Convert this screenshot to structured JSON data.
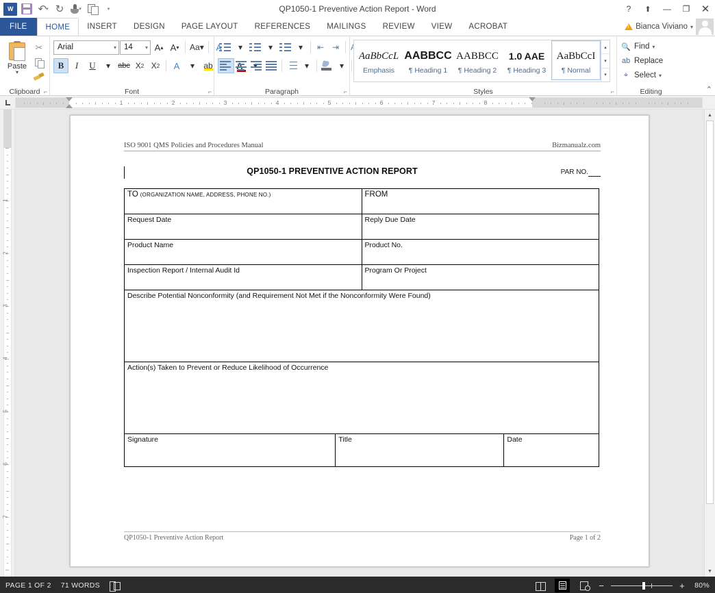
{
  "window": {
    "title": "QP1050-1 Preventive Action Report - Word",
    "quick_access": [
      {
        "name": "word-logo-icon",
        "label": "W"
      },
      {
        "name": "save-icon",
        "label": "Save"
      },
      {
        "name": "undo-icon",
        "label": "Undo"
      },
      {
        "name": "redo-icon",
        "label": "Redo"
      },
      {
        "name": "touch-mode-icon",
        "label": "Touch/Mouse Mode"
      },
      {
        "name": "copy-format-icon",
        "label": "Copy"
      },
      {
        "name": "customize-qat-icon",
        "label": "Customize Quick Access Toolbar"
      }
    ],
    "controls": {
      "help": "?",
      "ribbon_display": "⬆",
      "minimize": "—",
      "restore": "❐",
      "close": "✕"
    }
  },
  "tabs": {
    "file": "FILE",
    "items": [
      "HOME",
      "INSERT",
      "DESIGN",
      "PAGE LAYOUT",
      "REFERENCES",
      "MAILINGS",
      "REVIEW",
      "VIEW",
      "ACROBAT"
    ],
    "active": "HOME"
  },
  "account": {
    "name": "Bianca Viviano",
    "caret": "▾"
  },
  "ribbon": {
    "collapse_caret": "⌃",
    "groups": {
      "clipboard": {
        "label": "Clipboard",
        "paste_label": "Paste",
        "paste_caret": "▾",
        "dialog_launcher": "⌐",
        "cut_label": "Cut",
        "copy_label": "Copy",
        "format_painter_label": "Format Painter"
      },
      "font": {
        "label": "Font",
        "dialog_launcher": "⌐",
        "font_name": "Arial",
        "font_size": "14",
        "caret": "▾",
        "grow_font": "A",
        "shrink_font": "A",
        "change_case": "Aa",
        "clear_formatting": "A",
        "bold": "B",
        "italic": "I",
        "underline": "U",
        "strikethrough": "abc",
        "subscript": "X",
        "superscript": "X",
        "text_effects": "A",
        "highlight": "ab",
        "font_color": "A"
      },
      "paragraph": {
        "label": "Paragraph",
        "dialog_launcher": "⌐",
        "bullets": "Bullets",
        "numbering": "Numbering",
        "multilevel": "Multilevel List",
        "decrease_indent": "⇤",
        "increase_indent": "⇥",
        "sort": "A↓",
        "show_marks": "¶",
        "align_left": "Align Left",
        "align_center": "Center",
        "align_right": "Align Right",
        "justify": "Justify",
        "line_spacing": "Line Spacing",
        "shading": "Shading",
        "borders": "Borders"
      },
      "styles": {
        "label": "Styles",
        "dialog_launcher": "⌐",
        "scroll_up": "▴",
        "scroll_down": "▾",
        "more": "▾",
        "items": [
          {
            "preview": "AaBbCcL",
            "name": "Emphasis",
            "selected": false
          },
          {
            "preview": "AABBCC",
            "name": "¶ Heading 1",
            "selected": false
          },
          {
            "preview": "AABBCC",
            "name": "¶ Heading 2",
            "selected": false
          },
          {
            "preview": "1.0 AAE",
            "name": "¶ Heading 3",
            "selected": false
          },
          {
            "preview": "AaBbCcI",
            "name": "¶ Normal",
            "selected": true
          }
        ]
      },
      "editing": {
        "label": "Editing",
        "find": "Find",
        "find_caret": "▾",
        "replace": "Replace",
        "select": "Select",
        "select_caret": "▾"
      }
    }
  },
  "ruler": {
    "tab_selector": "L",
    "h_numbers": [
      "1",
      "1",
      "2",
      "3",
      "4",
      "5",
      "6",
      "7",
      "8"
    ],
    "v_numbers": [
      "1",
      "2",
      "3",
      "4",
      "5",
      "6",
      "7"
    ]
  },
  "document": {
    "header_left": "ISO 9001 QMS Policies and Procedures Manual",
    "header_right": "Bizmanualz.com",
    "title": "QP1050-1 PREVENTIVE ACTION REPORT",
    "par_no_label": "PAR NO.",
    "par_no_value": "",
    "rows": [
      {
        "left_main": "TO",
        "left_note": "(ORGANIZATION NAME, ADDRESS, PHONE NO.)",
        "right": "FROM"
      },
      {
        "left_main": "Request Date",
        "left_note": "",
        "right": "Reply Due Date"
      },
      {
        "left_main": "Product Name",
        "left_note": "",
        "right": "Product No."
      },
      {
        "left_main": "Inspection Report / Internal Audit Id",
        "left_note": "",
        "right": "Program Or Project"
      }
    ],
    "section_describe": "Describe Potential Nonconformity (and Requirement Not Met if the Nonconformity Were Found)",
    "section_actions": "Action(s) Taken to Prevent or Reduce Likelihood of Occurrence",
    "signature_row": [
      "Signature",
      "Title",
      "Date"
    ],
    "footer_left": "QP1050-1 Preventive Action Report",
    "footer_right": "Page 1 of 2"
  },
  "statusbar": {
    "page": "PAGE 1 OF 2",
    "words": "71 WORDS",
    "proofing_icon": "proofing-errors-icon",
    "views": [
      {
        "name": "read-mode-view-button",
        "active": false
      },
      {
        "name": "print-layout-view-button",
        "active": true
      },
      {
        "name": "web-layout-view-button",
        "active": false
      }
    ],
    "zoom_out": "−",
    "zoom_in": "+",
    "zoom_value": "80%"
  }
}
